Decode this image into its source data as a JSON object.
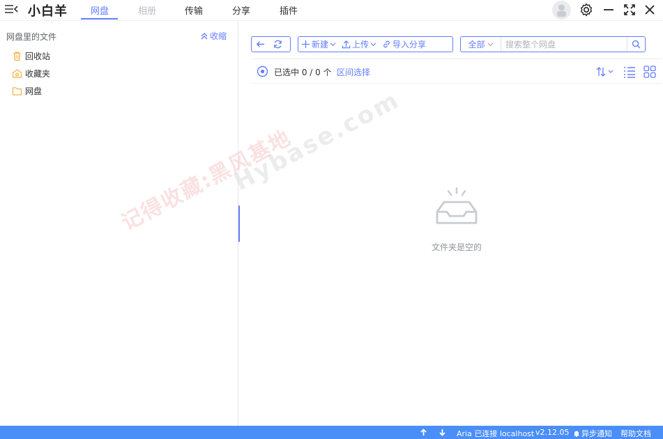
{
  "app": {
    "title": "小白羊"
  },
  "tabs": [
    {
      "label": "网盘",
      "state": "active"
    },
    {
      "label": "相册",
      "state": "disabled"
    },
    {
      "label": "传输",
      "state": "normal"
    },
    {
      "label": "分享",
      "state": "normal"
    },
    {
      "label": "插件",
      "state": "normal"
    }
  ],
  "sidebar": {
    "header": "网盘里的文件",
    "collapse_label": "收缩",
    "items": [
      {
        "label": "回收站",
        "icon": "trash-icon"
      },
      {
        "label": "收藏夹",
        "icon": "star-folder-icon"
      },
      {
        "label": "网盘",
        "icon": "folder-icon"
      }
    ]
  },
  "toolbar": {
    "new_label": "新建",
    "upload_label": "上传",
    "import_share_label": "导入分享",
    "search_scope": "全部",
    "search_placeholder": "搜索整个网盘",
    "search_value": ""
  },
  "selection": {
    "label": "已选中 0 / 0 个",
    "range_select": "区间选择"
  },
  "empty": {
    "text": "文件夹是空的"
  },
  "watermark": {
    "line1": "记得收藏:黑风基地",
    "line2": "Hybase.com"
  },
  "statusbar": {
    "aria": "Aria 已连接 localhost",
    "version": "v2.12.05",
    "notify": "异步通知",
    "help": "帮助文档"
  },
  "colors": {
    "accent": "#637dff",
    "statusbar": "#4a8ef7",
    "folder": "#f5b142"
  }
}
